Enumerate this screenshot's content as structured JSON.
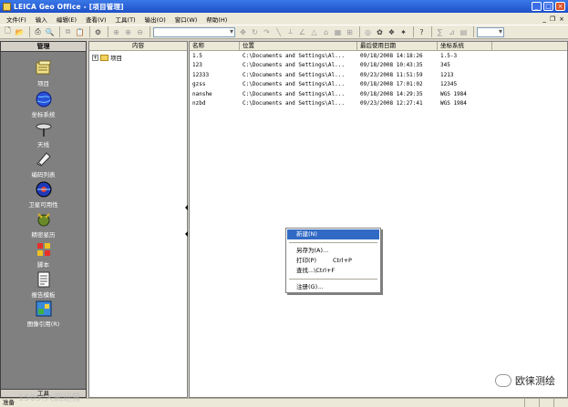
{
  "window": {
    "title": "LEICA Geo Office  - [项目管理]",
    "min": "_",
    "max": "□",
    "close": "×"
  },
  "menu": [
    "文件(F)",
    "输入",
    "编辑(E)",
    "查看(V)",
    "工具(T)",
    "输出(O)",
    "窗口(W)",
    "帮助(H)"
  ],
  "menu_mdi": {
    "min": "_",
    "restore": "❐",
    "close": "×"
  },
  "nav": {
    "header": "管理",
    "items": [
      {
        "label": "项目",
        "icon": "project-icon"
      },
      {
        "label": "坐标系统",
        "icon": "globe-icon"
      },
      {
        "label": "天线",
        "icon": "antenna-icon"
      },
      {
        "label": "编码列表",
        "icon": "codelist-icon"
      },
      {
        "label": "卫星可用性",
        "icon": "satellite-icon"
      },
      {
        "label": "精密星历",
        "icon": "ephemeris-icon"
      },
      {
        "label": "脚本",
        "icon": "script-icon"
      },
      {
        "label": "报告模板",
        "icon": "report-icon"
      },
      {
        "label": "图像引用(R)",
        "icon": "image-icon"
      }
    ],
    "footer": "工具"
  },
  "tree": {
    "header": "内容",
    "root": "项目",
    "expander": "+"
  },
  "list": {
    "columns": [
      "名称",
      "位置",
      "最后使用日期",
      "坐标系统"
    ],
    "rows": [
      [
        "1.5",
        "C:\\Documents and Settings\\Al...",
        "09/18/2008 14:18:26",
        "1.5-3"
      ],
      [
        "123",
        "C:\\Documents and Settings\\Al...",
        "09/18/2008 10:43:35",
        "345"
      ],
      [
        "12333",
        "C:\\Documents and Settings\\Al...",
        "09/23/2008 11:51:59",
        "1213"
      ],
      [
        "gzss",
        "C:\\Documents and Settings\\Al...",
        "09/18/2008 17:01:02",
        "12345"
      ],
      [
        "nanshe",
        "C:\\Documents and Settings\\Al...",
        "09/18/2008 14:29:35",
        "WGS 1984"
      ],
      [
        "nzbd",
        "C:\\Documents and Settings\\Al...",
        "09/23/2008 12:27:41",
        "WGS 1984"
      ]
    ]
  },
  "context_menu": {
    "new": "新建(N)",
    "save_as": "另存为(A)...",
    "print": "打印(P)",
    "print_sc": "Ctrl+P",
    "find": "查找...\\Ctrl+F",
    "properties": "注册(G)..."
  },
  "status": {
    "text": "准备"
  },
  "watermark": {
    "brand": "欧徕测绘",
    "site": "1505.大武运营"
  }
}
